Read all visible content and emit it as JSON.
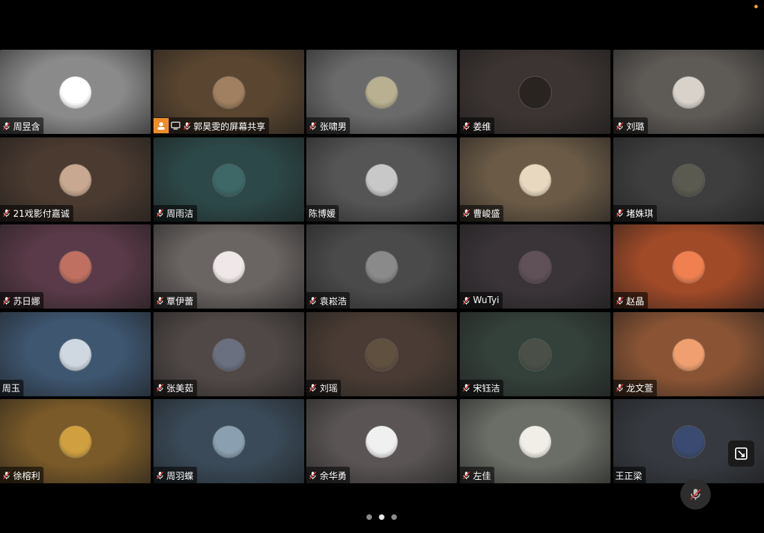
{
  "participants": [
    {
      "name": "周昱含",
      "bg": "#8a8a8a",
      "av": "#ffffff",
      "mic": true
    },
    {
      "name": "郭昊雯的屏幕共享",
      "bg": "#5a4630",
      "av": "#a08060",
      "mic": true,
      "share": true
    },
    {
      "name": "张啸男",
      "bg": "#6a6a6a",
      "av": "#b8b090",
      "mic": true
    },
    {
      "name": "姜维",
      "bg": "#3c3432",
      "av": "#2a2420",
      "mic": true
    },
    {
      "name": "刘璐",
      "bg": "#5e5a56",
      "av": "#d8d2ca",
      "mic": true
    },
    {
      "name": "21戏影付嘉诚",
      "bg": "#4a3a30",
      "av": "#c8a890",
      "mic": true
    },
    {
      "name": "周雨洁",
      "bg": "#2d4848",
      "av": "#3e6868",
      "mic": true
    },
    {
      "name": "陈博媛",
      "bg": "#555555",
      "av": "#c8c8c8",
      "mic": false
    },
    {
      "name": "曹峻盛",
      "bg": "#6a5a46",
      "av": "#e8d8c0",
      "mic": true
    },
    {
      "name": "堵姝琪",
      "bg": "#3e3e3e",
      "av": "#5a5a50",
      "mic": true
    },
    {
      "name": "苏日娜",
      "bg": "#5a3a48",
      "av": "#c07060",
      "mic": true
    },
    {
      "name": "覃伊蕾",
      "bg": "#6a6462",
      "av": "#f0e8e8",
      "mic": true
    },
    {
      "name": "袁崧浩",
      "bg": "#4a4a4a",
      "av": "#8a8a8a",
      "mic": true
    },
    {
      "name": "WuTyi",
      "bg": "#3a3438",
      "av": "#605058",
      "mic": true
    },
    {
      "name": "赵晶",
      "bg": "#a04a28",
      "av": "#f08050",
      "mic": true
    },
    {
      "name": "周玉",
      "bg": "#3e5670",
      "av": "#cfd8e0",
      "mic": false
    },
    {
      "name": "张美茹",
      "bg": "#504846",
      "av": "#6a7080",
      "mic": true
    },
    {
      "name": "刘瑶",
      "bg": "#4a3c34",
      "av": "#605040",
      "mic": true
    },
    {
      "name": "宋钰洁",
      "bg": "#34403a",
      "av": "#4a5048",
      "mic": true
    },
    {
      "name": "龙文萱",
      "bg": "#8a5434",
      "av": "#f0a070",
      "mic": true
    },
    {
      "name": "徐榕利",
      "bg": "#7a5a28",
      "av": "#d0a040",
      "mic": true
    },
    {
      "name": "周羽蝶",
      "bg": "#3a4a58",
      "av": "#8aa0b0",
      "mic": true
    },
    {
      "name": "余华勇",
      "bg": "#5a5454",
      "av": "#f0f0f0",
      "mic": true
    },
    {
      "name": "左佳",
      "bg": "#6a6e66",
      "av": "#f0eee6",
      "mic": true
    },
    {
      "name": "王正梁",
      "bg": "#363a40",
      "av": "#3a4a70",
      "mic": false
    }
  ],
  "pager": {
    "count": 3,
    "active": 1
  }
}
